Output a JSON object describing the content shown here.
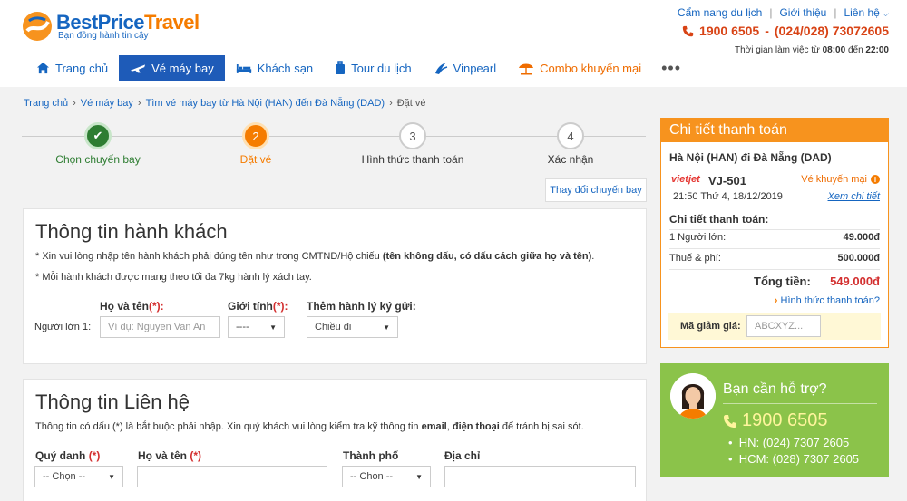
{
  "brand": {
    "name_blue": "BestPrice",
    "name_orange": "Travel",
    "tagline": "Bạn đồng hành tin cậy"
  },
  "top_links": [
    "Cẩm nang du lịch",
    "Giới thiệu",
    "Liên hệ"
  ],
  "hotline": {
    "number": "1900 6505",
    "dash": "-",
    "alt": "(024/028) 73072605"
  },
  "hours": {
    "prefix": "Thời gian làm việc từ",
    "start": "08:00",
    "middle": "đến",
    "end": "22:00"
  },
  "nav": [
    {
      "label": "Trang chủ",
      "icon": "home-icon",
      "active": false
    },
    {
      "label": "Vé máy bay",
      "icon": "plane-icon",
      "active": true
    },
    {
      "label": "Khách sạn",
      "icon": "bed-icon",
      "active": false
    },
    {
      "label": "Tour du lịch",
      "icon": "luggage-icon",
      "active": false
    },
    {
      "label": "Vinpearl",
      "icon": "vinpearl-icon",
      "active": false
    },
    {
      "label": "Combo khuyến mại",
      "icon": "beach-umbrella-icon",
      "active": false
    }
  ],
  "nav_more": "•••",
  "breadcrumb": [
    "Trang chủ",
    "Vé máy bay",
    "Tìm vé máy bay từ Hà Nội (HAN) đến Đà Nẵng (DAD)",
    "Đặt vé"
  ],
  "breadcrumb_sep": "›",
  "steps": [
    {
      "number": "✔",
      "label": "Chọn chuyến bay",
      "state": "done"
    },
    {
      "number": "2",
      "label": "Đặt vé",
      "state": "current"
    },
    {
      "number": "3",
      "label": "Hình thức thanh toán",
      "state": "pending"
    },
    {
      "number": "4",
      "label": "Xác nhận",
      "state": "pending"
    }
  ],
  "change_flight": "Thay đổi chuyến bay",
  "passenger": {
    "title": "Thông tin hành khách",
    "note1_plain": "* Xin vui lòng nhập tên hành khách phải đúng tên như trong CMTND/Hộ chiếu",
    "note1_bold": "(tên không dấu, có dấu cách giữa họ và tên)",
    "note1_end": ".",
    "note2": "* Mỗi hành khách được mang theo tối đa 7kg hành lý xách tay.",
    "name_label": "Họ và tên",
    "gender_label": "Giới tính",
    "baggage_label": "Thêm hành lý ký gửi:",
    "required_mark": "(*):",
    "row_label": "Người lớn 1:",
    "name_placeholder": "Ví dụ: Nguyen Van An",
    "gender_value": "----",
    "baggage_value": "Chiều đi"
  },
  "contact": {
    "title": "Thông tin Liên hệ",
    "note_a": "Thông tin có dấu (*) là bắt buộc phải nhập. Xin quý khách vui lòng kiểm tra kỹ thông tin",
    "note_email": "email",
    "note_comma": ",",
    "note_phone": "điện thoại",
    "note_end": "để tránh bị sai sót.",
    "title_label": "Quý danh",
    "name_label": "Họ và tên",
    "city_label": "Thành phố",
    "address_label": "Địa chỉ",
    "required_mark": "(*)",
    "title_value": "-- Chọn --",
    "city_value": "-- Chọn --"
  },
  "payment": {
    "header": "Chi tiết thanh toán",
    "route": "Hà Nội (HAN) đi Đà Nẵng (DAD)",
    "airline_logo": "vietjet",
    "flight_code": "VJ-501",
    "promo": "Vé khuyến mại",
    "promo_icon": "i",
    "datetime": "21:50 Thứ 4, 18/12/2019",
    "detail_link": "Xem chi tiết",
    "subheader": "Chi tiết thanh toán:",
    "rows": [
      {
        "label": "1 Người lớn:",
        "value": "49.000đ"
      },
      {
        "label": "Thuế & phí:",
        "value": "500.000đ"
      }
    ],
    "total_label": "Tổng tiền:",
    "total_value": "549.000đ",
    "method_chev": "›",
    "method_link": "Hình thức thanh toán?",
    "coupon_label": "Mã giảm giá:",
    "coupon_placeholder": "ABCXYZ..."
  },
  "support": {
    "title": "Bạn cần hỗ trợ?",
    "phone": "1900 6505",
    "lines": [
      "HN: (024) 7307 2605",
      "HCM: (028) 7307 2605"
    ],
    "bullet": "•"
  },
  "colors": {
    "brand_blue": "#1565c0",
    "brand_orange": "#f7931e",
    "nav_active": "#1e5bb8",
    "hotline_red": "#d84315",
    "step_done": "#2e7d32",
    "step_current": "#f57c00",
    "support_green": "#8bc34a"
  }
}
